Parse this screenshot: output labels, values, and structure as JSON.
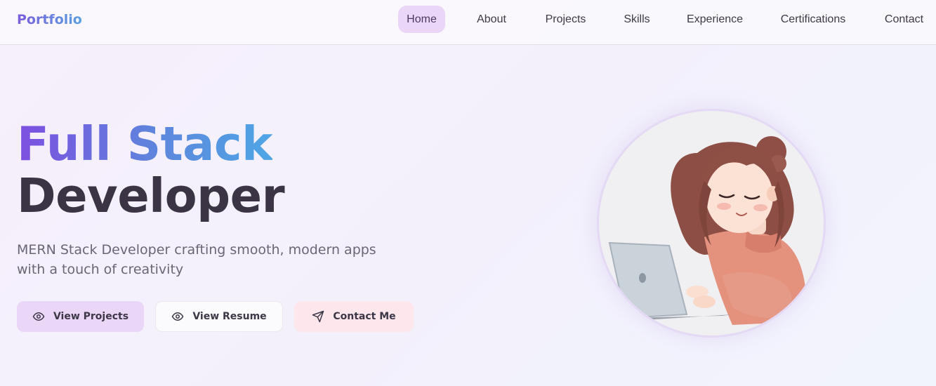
{
  "brand": {
    "name": "Portfolio"
  },
  "nav": {
    "items": [
      {
        "label": "Home",
        "active": true
      },
      {
        "label": "About",
        "active": false
      },
      {
        "label": "Projects",
        "active": false
      },
      {
        "label": "Skills",
        "active": false
      },
      {
        "label": "Experience",
        "active": false
      },
      {
        "label": "Certifications",
        "active": false
      },
      {
        "label": "Contact",
        "active": false
      }
    ]
  },
  "hero": {
    "title_line1": "Full Stack",
    "title_line2": "Developer",
    "subtitle": "MERN Stack Developer crafting smooth, modern apps with a touch of creativity",
    "buttons": {
      "view_projects": {
        "label": "View Projects",
        "icon": "eye-icon"
      },
      "view_resume": {
        "label": "View Resume",
        "icon": "eye-icon"
      },
      "contact_me": {
        "label": "Contact Me",
        "icon": "send-icon"
      }
    }
  },
  "avatar": {
    "description": "illustrated-developer-avatar"
  },
  "colors": {
    "accent_purple": "#7d4fe0",
    "accent_blue": "#4fa6e6",
    "nav_active_bg": "#ead6f7",
    "btn_projects_bg": "#ead7f8",
    "btn_contact_bg": "#fde6ec"
  }
}
